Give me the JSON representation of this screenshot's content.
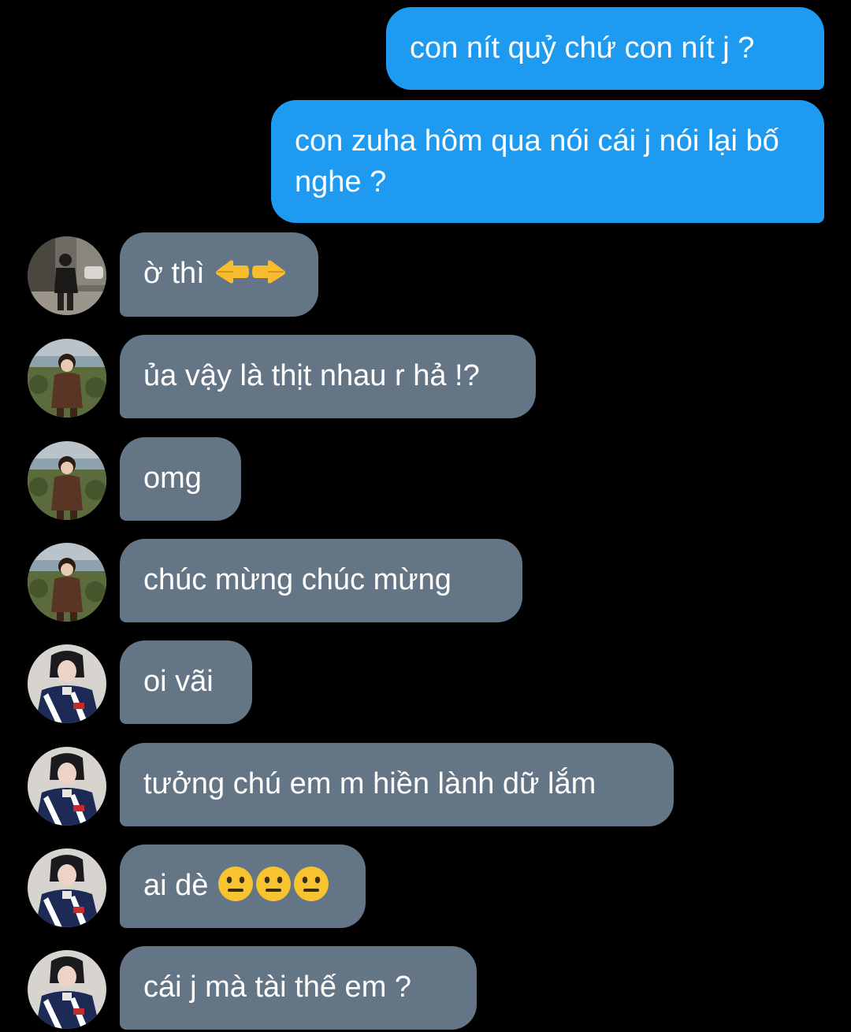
{
  "colors": {
    "background": "#000000",
    "sent_bubble": "#1e9bf0",
    "received_bubble": "#647585",
    "text": "#ffffff"
  },
  "messages": [
    {
      "direction": "sent",
      "text": "con nít quỷ chứ con nít j ?"
    },
    {
      "direction": "sent",
      "text": "con zuha hôm qua nói cái j nói lại bố nghe ?"
    },
    {
      "direction": "received",
      "sender_avatar": "avatar-street-photo",
      "text": "ờ thì",
      "emojis": [
        "pointing-left-icon",
        "pointing-right-icon"
      ]
    },
    {
      "direction": "received",
      "sender_avatar": "avatar-child-photo",
      "text": "ủa vậy là thịt nhau r hả !?"
    },
    {
      "direction": "received",
      "sender_avatar": "avatar-child-photo",
      "text": "omg"
    },
    {
      "direction": "received",
      "sender_avatar": "avatar-child-photo",
      "text": "chúc mừng chúc mừng"
    },
    {
      "direction": "received",
      "sender_avatar": "avatar-racer-photo",
      "text": "oi vãi"
    },
    {
      "direction": "received",
      "sender_avatar": "avatar-racer-photo",
      "text": "tưởng chú em m hiền lành dữ lắm"
    },
    {
      "direction": "received",
      "sender_avatar": "avatar-racer-photo",
      "text": "ai dè",
      "emojis": [
        "neutral-face-icon",
        "neutral-face-icon",
        "neutral-face-icon"
      ]
    },
    {
      "direction": "received",
      "sender_avatar": "avatar-racer-photo",
      "text": "cái j mà tài thế em ?"
    }
  ]
}
